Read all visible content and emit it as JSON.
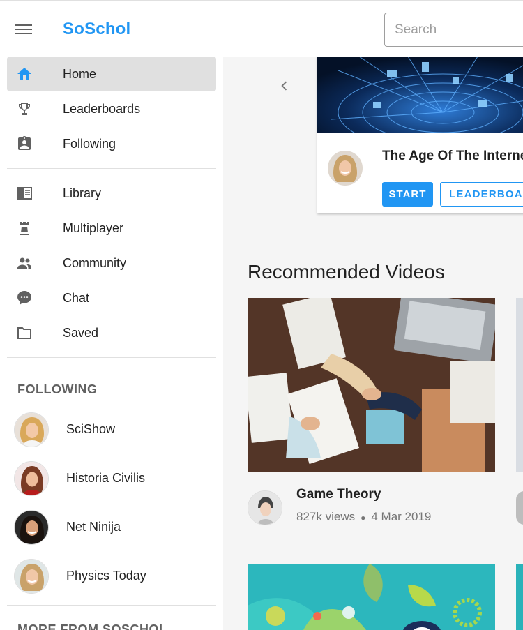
{
  "header": {
    "brand": "SoSchol",
    "search_placeholder": "Search"
  },
  "sidebar": {
    "nav_primary": [
      {
        "label": "Home",
        "icon": "home-icon",
        "active": true
      },
      {
        "label": "Leaderboards",
        "icon": "trophy-icon"
      },
      {
        "label": "Following",
        "icon": "clipboard-account-icon"
      }
    ],
    "nav_secondary": [
      {
        "label": "Library",
        "icon": "library-icon"
      },
      {
        "label": "Multiplayer",
        "icon": "chess-rook-icon"
      },
      {
        "label": "Community",
        "icon": "people-icon"
      },
      {
        "label": "Chat",
        "icon": "chat-icon"
      },
      {
        "label": "Saved",
        "icon": "folder-icon"
      }
    ],
    "following_title": "FOLLOWING",
    "following": [
      {
        "label": "SciShow"
      },
      {
        "label": "Historia Civilis"
      },
      {
        "label": "Net Ninija"
      },
      {
        "label": "Physics Today"
      }
    ],
    "more_title": "MORE FROM SOSCHOL"
  },
  "featured": {
    "title": "The Age Of The Internet",
    "start_label": "START",
    "leaderboard_label": "LEADERBOARD"
  },
  "recommended": {
    "title": "Recommended Videos",
    "videos": [
      {
        "title": "Game Theory",
        "views": "827k views",
        "date": "4 Mar 2019"
      }
    ]
  },
  "colors": {
    "accent": "#2196f3",
    "active_nav_bg": "#e0e0e0",
    "icon_gray": "#616161"
  }
}
